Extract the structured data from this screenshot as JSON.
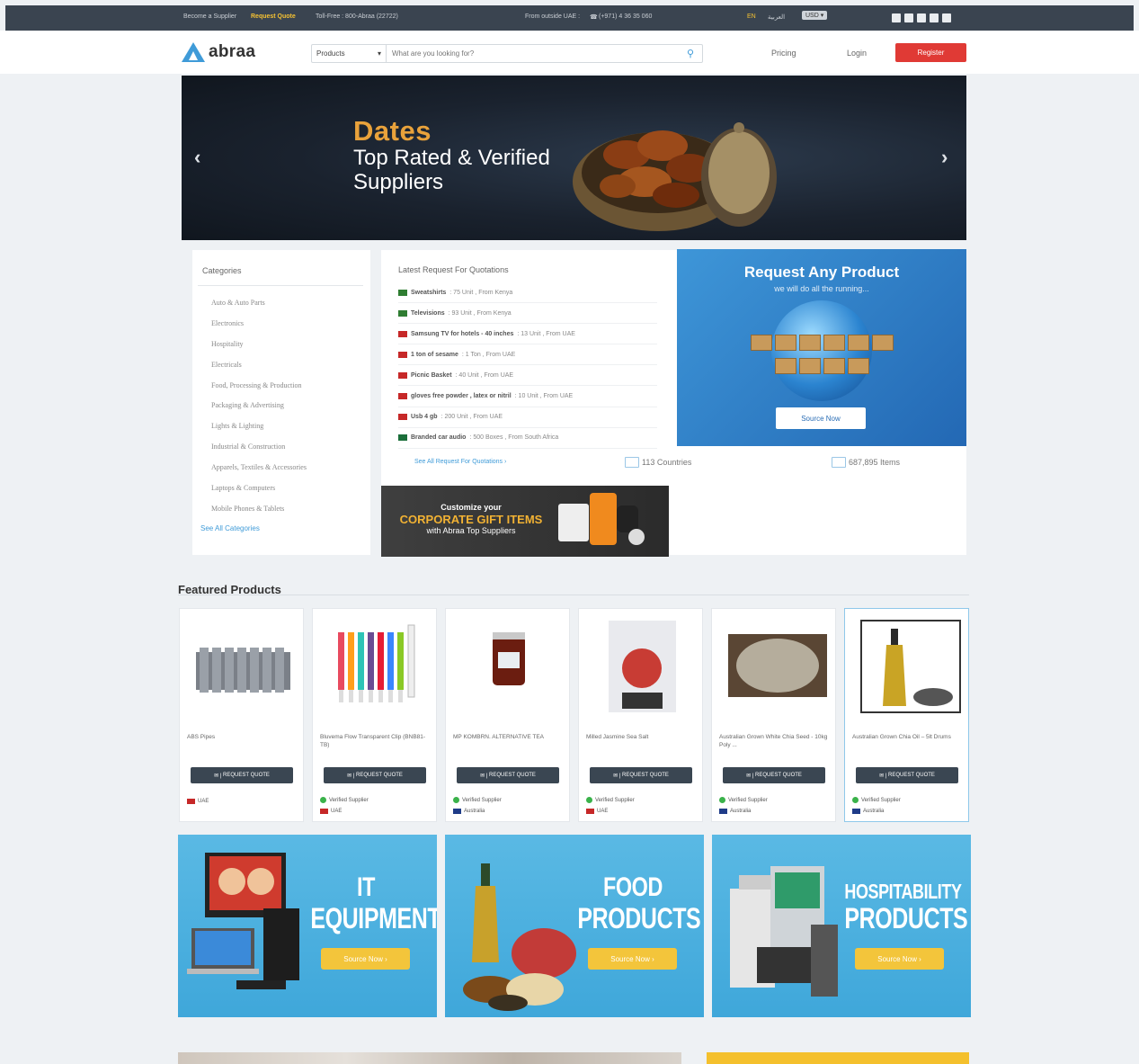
{
  "topbar": {
    "become_supplier": "Become a Supplier",
    "request_quote": "Request Quote",
    "toll_free": "Toll-Free : 800-Abraa (22722)",
    "from_outside": "From outside UAE :",
    "phone": "(+971) 4 36 35 060",
    "lang_en": "EN",
    "lang_ar": "العربية",
    "currency": "USD ▾"
  },
  "header": {
    "logo": "abraa",
    "search_category": "Products",
    "search_placeholder": "What are you looking for?",
    "pricing": "Pricing",
    "login": "Login",
    "register": "Register"
  },
  "banner": {
    "title": "Dates",
    "subtitle": "Top Rated & Verified Suppliers",
    "prev": "‹",
    "next": "›"
  },
  "categories": {
    "heading": "Categories",
    "items": [
      "Auto & Auto Parts",
      "Electronics",
      "Hospitality",
      "Electricals",
      "Food, Processing & Production",
      "Packaging & Advertising",
      "Lights & Lighting",
      "Industrial & Construction",
      "Apparels, Textiles & Accessories",
      "Laptops & Computers",
      "Mobile Phones & Tablets"
    ],
    "see_all": "See All Categories"
  },
  "rfq": {
    "heading": "Latest Request For Quotations",
    "items": [
      {
        "name": "Sweatshirts",
        "detail": " : 75 Unit , From Kenya",
        "flag_color": "#2f7d32"
      },
      {
        "name": "Televisions",
        "detail": " : 93 Unit , From Kenya",
        "flag_color": "#2f7d32"
      },
      {
        "name": "Samsung TV for hotels - 40 inches",
        "detail": " : 13 Unit , From UAE",
        "flag_color": "#c62828"
      },
      {
        "name": "1 ton of sesame",
        "detail": " : 1 Ton , From UAE",
        "flag_color": "#c62828"
      },
      {
        "name": "Picnic Basket",
        "detail": " : 40 Unit , From UAE",
        "flag_color": "#c62828"
      },
      {
        "name": "gloves free powder , latex or nitril",
        "detail": " : 10 Unit , From UAE",
        "flag_color": "#c62828"
      },
      {
        "name": "Usb 4 gb",
        "detail": " : 200 Unit , From UAE",
        "flag_color": "#c62828"
      },
      {
        "name": "Branded car audio",
        "detail": " : 500 Boxes , From South Africa",
        "flag_color": "#1b6e3a"
      }
    ],
    "see_all": "See All Request For Quotations ›",
    "countries": "113 Countries",
    "items_count": "687,895 Items"
  },
  "request_any": {
    "title": "Request Any Product",
    "subtitle": "we will do all the running...",
    "button": "Source Now"
  },
  "gift": {
    "line1": "Customize your",
    "line2": "CORPORATE GIFT ITEMS",
    "line3": "with Abraa Top Suppliers"
  },
  "featured": {
    "heading": "Featured Products",
    "button_label": "REQUEST QUOTE",
    "verified_label": "Verified Supplier",
    "products": [
      {
        "name": "ABS Pipes",
        "verified": false,
        "country": "UAE"
      },
      {
        "name": "Bluvema Flow Transparent Clip (BNB81-TB)",
        "verified": true,
        "country": "UAE"
      },
      {
        "name": "MP KOMBRN. ALTERNATIVE TEA",
        "verified": true,
        "country": "Australia"
      },
      {
        "name": "Milled Jasmine Sea Salt",
        "verified": true,
        "country": "UAE"
      },
      {
        "name": "Australian Grown White Chia Seed - 10kg Poly ...",
        "verified": true,
        "country": "Australia"
      },
      {
        "name": "Australian Grown Chia Oil – 5lt Drums",
        "verified": true,
        "country": "Australia"
      }
    ]
  },
  "promos": [
    {
      "line1": "IT",
      "line2": "EQUIPMENT",
      "button": "Source Now ›"
    },
    {
      "line1": "FOOD",
      "line2": "PRODUCTS",
      "button": "Source Now ›"
    },
    {
      "line1": "HOSPITABILITY",
      "line2": "PRODUCTS",
      "button": "Source Now ›"
    }
  ],
  "colors": {
    "topbar": "#3a4450",
    "accent": "#3f9bd8",
    "register": "#e03a35",
    "gold": "#f5c132",
    "promo": "#4fb2e0"
  }
}
